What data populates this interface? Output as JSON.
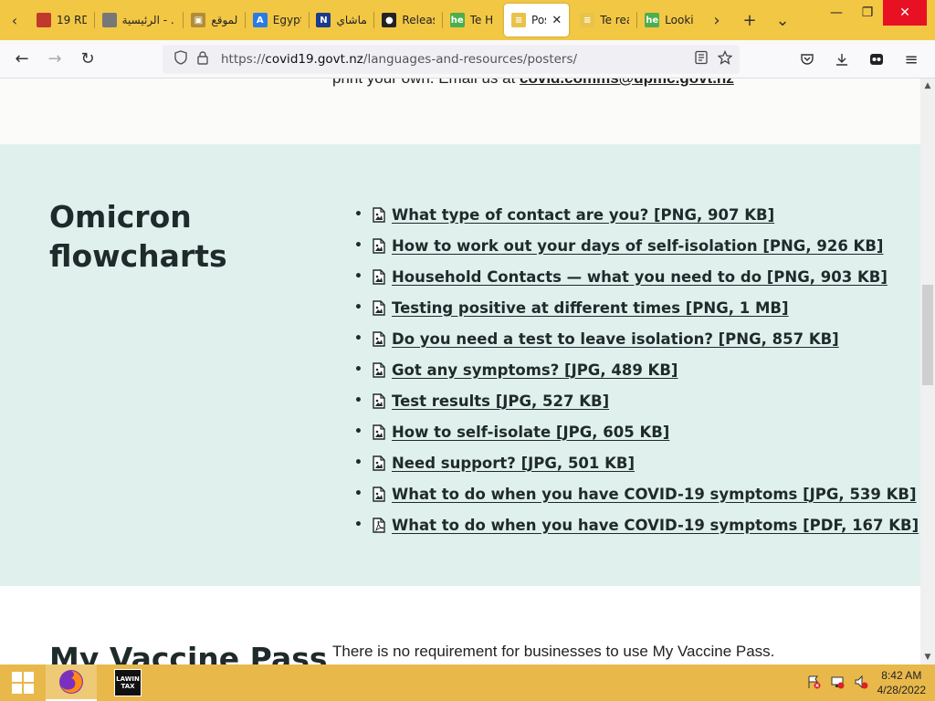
{
  "browser": {
    "tabs": [
      {
        "label": "19 RD",
        "color": "#c0392b",
        "glyph": ""
      },
      {
        "label": "الرئيسية - ...",
        "color": "#777777",
        "glyph": ""
      },
      {
        "label": "الموقع",
        "color": "#b08d3a",
        "glyph": "▣"
      },
      {
        "label": "Egypt",
        "color": "#2a7be4",
        "glyph": "A"
      },
      {
        "label": "تماشاي",
        "color": "#1a3c8c",
        "glyph": "N"
      },
      {
        "label": "Releas",
        "color": "#222222",
        "glyph": "●"
      },
      {
        "label": "Te Hi",
        "color": "#4cae4c",
        "glyph": "he"
      },
      {
        "label": "Pos",
        "color": "#e8c34a",
        "glyph": "≡",
        "active": true
      },
      {
        "label": "Te rea",
        "color": "#e8c34a",
        "glyph": "≡"
      },
      {
        "label": "Lookii",
        "color": "#4cae4c",
        "glyph": "he"
      }
    ],
    "url_prefix": "https://",
    "url_host": "covid19.govt.nz",
    "url_path": "/languages-and-resources/posters/",
    "accent": "#f2c744"
  },
  "page": {
    "top_text": "print your own. Email us at ",
    "top_email": "covid.comms@dpmc.govt.nz",
    "section_title": "Omicron flowcharts",
    "files": [
      {
        "label": "What type of contact are you? [PNG, 907 KB]",
        "icon": "image-file-icon"
      },
      {
        "label": "How to work out your days of self-isolation [PNG, 926 KB]",
        "icon": "image-file-icon"
      },
      {
        "label": "Household Contacts — what you need to do [PNG, 903 KB]",
        "icon": "image-file-icon"
      },
      {
        "label": "Testing positive at different times [PNG, 1 MB]",
        "icon": "image-file-icon"
      },
      {
        "label": "Do you need a test to leave isolation? [PNG, 857 KB]",
        "icon": "image-file-icon"
      },
      {
        "label": "Got any symptoms? [JPG, 489 KB]",
        "icon": "image-file-icon"
      },
      {
        "label": "Test results [JPG, 527 KB]",
        "icon": "image-file-icon"
      },
      {
        "label": "How to self-isolate [JPG, 605 KB]",
        "icon": "image-file-icon"
      },
      {
        "label": "Need support? [JPG, 501 KB]",
        "icon": "image-file-icon"
      },
      {
        "label": "What to do when you have COVID-19 symptoms [JPG, 539 KB]",
        "icon": "image-file-icon"
      },
      {
        "label": "What to do when you have COVID-19 symptoms [PDF, 167 KB]",
        "icon": "pdf-file-icon"
      }
    ],
    "vaccine_title": "My Vaccine Pass",
    "vaccine_text": "There is no requirement for businesses to use My Vaccine Pass.",
    "section_bg": "#e0f0ec"
  },
  "taskbar": {
    "time": "8:42 AM",
    "date": "4/28/2022",
    "app2_label": "LAWIN TAX"
  }
}
